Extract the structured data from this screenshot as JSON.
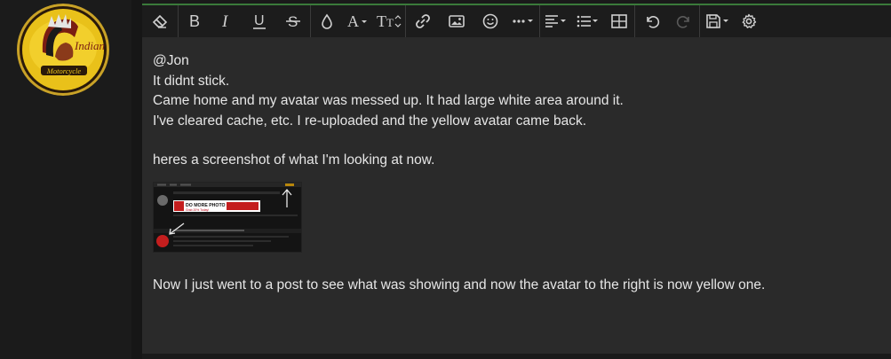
{
  "post": {
    "lines": [
      "@Jon",
      "It didnt stick.",
      "Came home and my avatar was messed up. It had large white area around it.",
      "I've cleared cache, etc. I re-uploaded and the yellow avatar came back."
    ],
    "line5": "heres a screenshot of what I'm looking at now.",
    "line6": "Now I just went to a post to see what was showing and now the avatar to the right is now yellow one."
  },
  "avatar": {
    "logo_lines": [
      "Indian",
      "Motorcycle"
    ],
    "colors": {
      "ring": "#c9a227",
      "face": "#e9c11a",
      "dark": "#2a1a0a"
    }
  },
  "thumbnail": {
    "banner_text": "DO MORE PHOTO",
    "banner_sub": "Grab 20% Today!"
  },
  "toolbar": {
    "icons": [
      "eraser-icon",
      "bold-icon",
      "italic-icon",
      "underline-icon",
      "strikethrough-icon",
      "text-color-icon",
      "font-family-icon",
      "font-size-icon",
      "link-icon",
      "image-icon",
      "emoji-icon",
      "more-icon",
      "align-icon",
      "list-icon",
      "table-icon",
      "undo-icon",
      "redo-icon",
      "drafts-icon",
      "settings-icon"
    ]
  },
  "colors": {
    "editor_bg": "#2a2a2a",
    "toolbar_bg": "#1c1c1c",
    "accent_border": "#3a7a3a",
    "text": "#e6e6e6"
  }
}
